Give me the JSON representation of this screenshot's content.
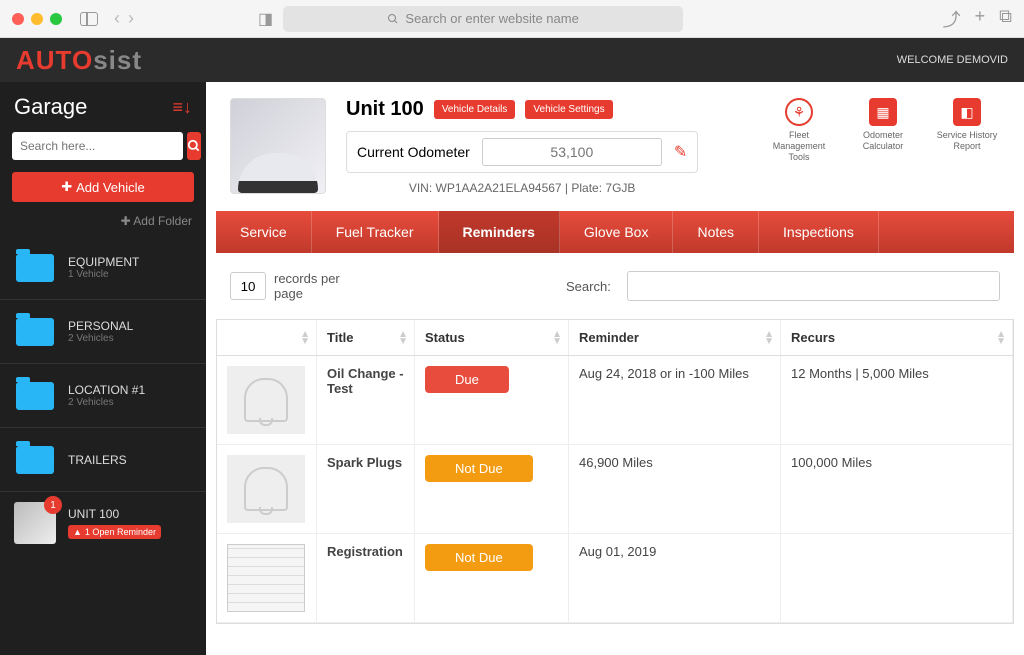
{
  "browser": {
    "url_placeholder": "Search or enter website name"
  },
  "header": {
    "logo_part1": "AUTO",
    "logo_part2": "sist",
    "welcome": "WELCOME DEMOVID"
  },
  "sidebar": {
    "title": "Garage",
    "search_placeholder": "Search here...",
    "add_vehicle": "Add Vehicle",
    "add_folder": "Add Folder",
    "folders": [
      {
        "name": "EQUIPMENT",
        "sub": "1 Vehicle"
      },
      {
        "name": "PERSONAL",
        "sub": "2 Vehicles"
      },
      {
        "name": "LOCATION #1",
        "sub": "2 Vehicles"
      },
      {
        "name": "TRAILERS",
        "sub": ""
      }
    ],
    "vehicle": {
      "name": "UNIT 100",
      "badge": "1",
      "reminder": "1 Open Reminder"
    }
  },
  "vehicle": {
    "title": "Unit 100",
    "details_btn": "Vehicle Details",
    "settings_btn": "Vehicle Settings",
    "odo_label": "Current Odometer",
    "odo_value": "53,100",
    "vin_plate": "VIN: WP1AA2A21ELA94567 | Plate: 7GJB",
    "tools": [
      {
        "label": "Fleet Management Tools"
      },
      {
        "label": "Odometer Calculator"
      },
      {
        "label": "Service History Report"
      }
    ]
  },
  "tabs": [
    {
      "label": "Service",
      "active": false
    },
    {
      "label": "Fuel Tracker",
      "active": false
    },
    {
      "label": "Reminders",
      "active": true
    },
    {
      "label": "Glove Box",
      "active": false
    },
    {
      "label": "Notes",
      "active": false
    },
    {
      "label": "Inspections",
      "active": false
    }
  ],
  "table": {
    "records_value": "10",
    "records_label": "records per page",
    "search_label": "Search:",
    "headers": {
      "title": "Title",
      "status": "Status",
      "reminder": "Reminder",
      "recurs": "Recurs"
    },
    "rows": [
      {
        "title": "Oil Change - Test",
        "status": "Due",
        "status_class": "status-due",
        "reminder": "Aug 24, 2018 or in -100 Miles",
        "recurs": "12 Months | 5,000 Miles",
        "thumb": "bell"
      },
      {
        "title": "Spark Plugs",
        "status": "Not Due",
        "status_class": "status-notdue",
        "reminder": "46,900 Miles",
        "recurs": "100,000 Miles",
        "thumb": "bell"
      },
      {
        "title": "Registration",
        "status": "Not Due",
        "status_class": "status-notdue",
        "reminder": "Aug 01, 2019",
        "recurs": "",
        "thumb": "doc"
      }
    ]
  }
}
